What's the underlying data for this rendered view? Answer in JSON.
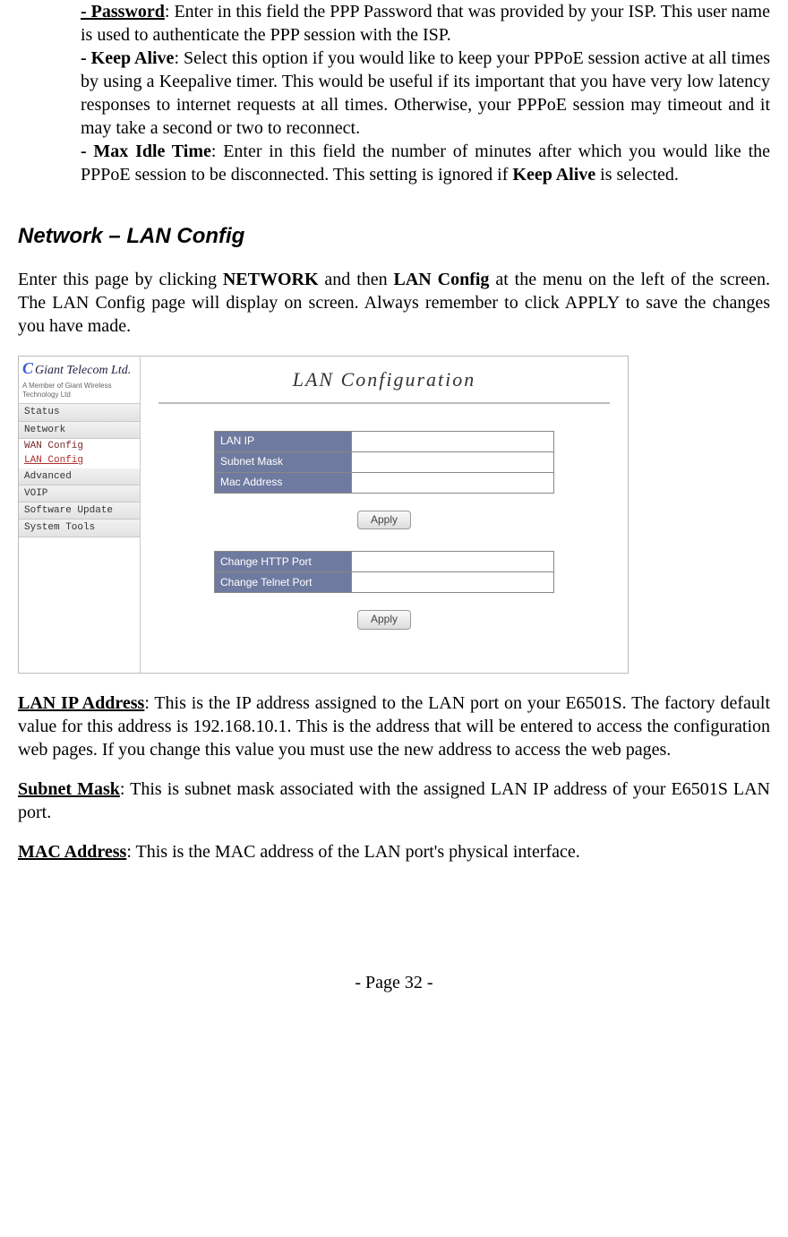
{
  "top": {
    "password_label": "- Password",
    "password_text": ": Enter in this field the PPP Password that was provided by your ISP. This user name is used to authenticate the PPP session with the ISP.",
    "keepalive_label": "- Keep Alive",
    "keepalive_text": ": Select this option if you would like to keep your PPPoE session active at all times by using a Keepalive timer. This would be useful if its important that you have very low latency responses to internet requests at all times.  Otherwise, your PPPoE session may timeout and it may take a second or two to reconnect.",
    "maxidle_label": "- Max Idle Time",
    "maxidle_text_a": ": Enter in this field the number of minutes after which you would like the PPPoE session to be disconnected. This setting is ignored if ",
    "maxidle_bold": "Keep Alive",
    "maxidle_text_b": " is selected."
  },
  "section_heading": "Network – LAN Config",
  "intro": {
    "a": "Enter this page by clicking ",
    "b": "NETWORK",
    "c": " and then ",
    "d": "LAN Config",
    "e": " at the menu on the left of the screen. The LAN Config page will display on screen. Always remember to click APPLY to save the changes you have made."
  },
  "mock": {
    "brand_c": "C",
    "brand": "Giant Telecom Ltd.",
    "brand_sub": "A Member of Giant Wireless Technology Ltd",
    "nav": {
      "status": "Status",
      "network": "Network",
      "wan": "WAN Config",
      "lan": "LAN Config",
      "advanced": "Advanced",
      "voip": "VOIP",
      "soft": "Software Update",
      "tools": "System Tools"
    },
    "title": "LAN Configuration",
    "rows1": {
      "lan_ip": "LAN IP",
      "subnet": "Subnet Mask",
      "mac": "Mac Address"
    },
    "rows2": {
      "http": "Change HTTP Port",
      "telnet": "Change Telnet Port"
    },
    "apply": "Apply"
  },
  "after": {
    "lanip_label": "LAN IP Address",
    "lanip_text": ": This is the IP address assigned to the LAN port on your E6501S. The factory default value for this address is 192.168.10.1.  This is the address that will be entered to access the configuration web pages.  If you change this value you must use the new address to access the web pages.",
    "subnet_label": "Subnet Mask",
    "subnet_text": ": This is subnet mask associated with the assigned LAN IP address of your E6501S LAN port.",
    "mac_label": "MAC Address",
    "mac_text": ": This is the MAC address of the LAN port's physical interface."
  },
  "footer": "- Page 32 -"
}
